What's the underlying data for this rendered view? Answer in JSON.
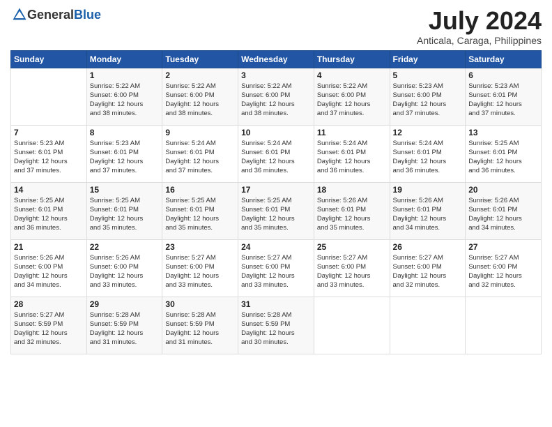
{
  "header": {
    "logo_general": "General",
    "logo_blue": "Blue",
    "month_year": "July 2024",
    "location": "Anticala, Caraga, Philippines"
  },
  "calendar": {
    "weekdays": [
      "Sunday",
      "Monday",
      "Tuesday",
      "Wednesday",
      "Thursday",
      "Friday",
      "Saturday"
    ],
    "weeks": [
      [
        {
          "day": "",
          "content": ""
        },
        {
          "day": "1",
          "content": "Sunrise: 5:22 AM\nSunset: 6:00 PM\nDaylight: 12 hours\nand 38 minutes."
        },
        {
          "day": "2",
          "content": "Sunrise: 5:22 AM\nSunset: 6:00 PM\nDaylight: 12 hours\nand 38 minutes."
        },
        {
          "day": "3",
          "content": "Sunrise: 5:22 AM\nSunset: 6:00 PM\nDaylight: 12 hours\nand 38 minutes."
        },
        {
          "day": "4",
          "content": "Sunrise: 5:22 AM\nSunset: 6:00 PM\nDaylight: 12 hours\nand 37 minutes."
        },
        {
          "day": "5",
          "content": "Sunrise: 5:23 AM\nSunset: 6:00 PM\nDaylight: 12 hours\nand 37 minutes."
        },
        {
          "day": "6",
          "content": "Sunrise: 5:23 AM\nSunset: 6:01 PM\nDaylight: 12 hours\nand 37 minutes."
        }
      ],
      [
        {
          "day": "7",
          "content": "Sunrise: 5:23 AM\nSunset: 6:01 PM\nDaylight: 12 hours\nand 37 minutes."
        },
        {
          "day": "8",
          "content": "Sunrise: 5:23 AM\nSunset: 6:01 PM\nDaylight: 12 hours\nand 37 minutes."
        },
        {
          "day": "9",
          "content": "Sunrise: 5:24 AM\nSunset: 6:01 PM\nDaylight: 12 hours\nand 37 minutes."
        },
        {
          "day": "10",
          "content": "Sunrise: 5:24 AM\nSunset: 6:01 PM\nDaylight: 12 hours\nand 36 minutes."
        },
        {
          "day": "11",
          "content": "Sunrise: 5:24 AM\nSunset: 6:01 PM\nDaylight: 12 hours\nand 36 minutes."
        },
        {
          "day": "12",
          "content": "Sunrise: 5:24 AM\nSunset: 6:01 PM\nDaylight: 12 hours\nand 36 minutes."
        },
        {
          "day": "13",
          "content": "Sunrise: 5:25 AM\nSunset: 6:01 PM\nDaylight: 12 hours\nand 36 minutes."
        }
      ],
      [
        {
          "day": "14",
          "content": "Sunrise: 5:25 AM\nSunset: 6:01 PM\nDaylight: 12 hours\nand 36 minutes."
        },
        {
          "day": "15",
          "content": "Sunrise: 5:25 AM\nSunset: 6:01 PM\nDaylight: 12 hours\nand 35 minutes."
        },
        {
          "day": "16",
          "content": "Sunrise: 5:25 AM\nSunset: 6:01 PM\nDaylight: 12 hours\nand 35 minutes."
        },
        {
          "day": "17",
          "content": "Sunrise: 5:25 AM\nSunset: 6:01 PM\nDaylight: 12 hours\nand 35 minutes."
        },
        {
          "day": "18",
          "content": "Sunrise: 5:26 AM\nSunset: 6:01 PM\nDaylight: 12 hours\nand 35 minutes."
        },
        {
          "day": "19",
          "content": "Sunrise: 5:26 AM\nSunset: 6:01 PM\nDaylight: 12 hours\nand 34 minutes."
        },
        {
          "day": "20",
          "content": "Sunrise: 5:26 AM\nSunset: 6:01 PM\nDaylight: 12 hours\nand 34 minutes."
        }
      ],
      [
        {
          "day": "21",
          "content": "Sunrise: 5:26 AM\nSunset: 6:00 PM\nDaylight: 12 hours\nand 34 minutes."
        },
        {
          "day": "22",
          "content": "Sunrise: 5:26 AM\nSunset: 6:00 PM\nDaylight: 12 hours\nand 33 minutes."
        },
        {
          "day": "23",
          "content": "Sunrise: 5:27 AM\nSunset: 6:00 PM\nDaylight: 12 hours\nand 33 minutes."
        },
        {
          "day": "24",
          "content": "Sunrise: 5:27 AM\nSunset: 6:00 PM\nDaylight: 12 hours\nand 33 minutes."
        },
        {
          "day": "25",
          "content": "Sunrise: 5:27 AM\nSunset: 6:00 PM\nDaylight: 12 hours\nand 33 minutes."
        },
        {
          "day": "26",
          "content": "Sunrise: 5:27 AM\nSunset: 6:00 PM\nDaylight: 12 hours\nand 32 minutes."
        },
        {
          "day": "27",
          "content": "Sunrise: 5:27 AM\nSunset: 6:00 PM\nDaylight: 12 hours\nand 32 minutes."
        }
      ],
      [
        {
          "day": "28",
          "content": "Sunrise: 5:27 AM\nSunset: 5:59 PM\nDaylight: 12 hours\nand 32 minutes."
        },
        {
          "day": "29",
          "content": "Sunrise: 5:28 AM\nSunset: 5:59 PM\nDaylight: 12 hours\nand 31 minutes."
        },
        {
          "day": "30",
          "content": "Sunrise: 5:28 AM\nSunset: 5:59 PM\nDaylight: 12 hours\nand 31 minutes."
        },
        {
          "day": "31",
          "content": "Sunrise: 5:28 AM\nSunset: 5:59 PM\nDaylight: 12 hours\nand 30 minutes."
        },
        {
          "day": "",
          "content": ""
        },
        {
          "day": "",
          "content": ""
        },
        {
          "day": "",
          "content": ""
        }
      ]
    ]
  }
}
